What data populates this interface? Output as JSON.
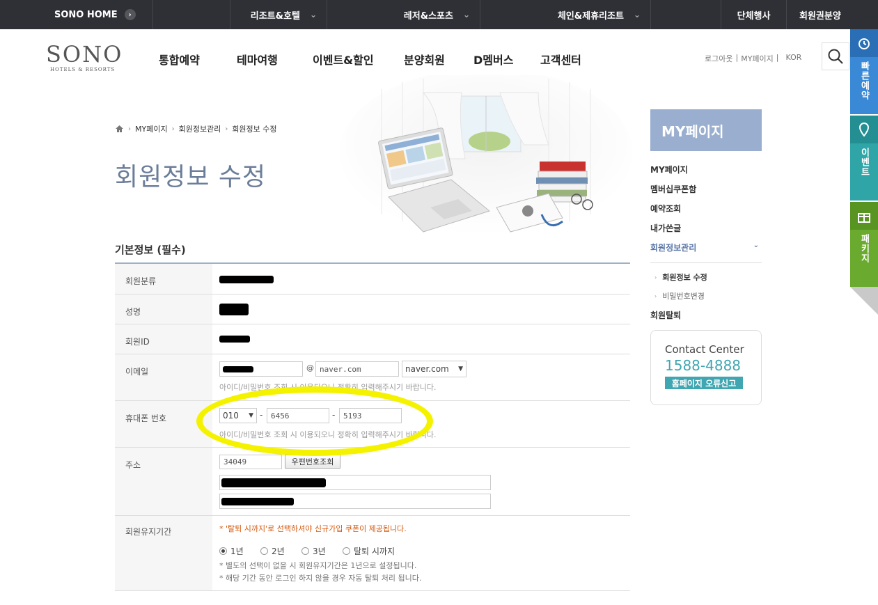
{
  "topbar": {
    "home": "SONO HOME",
    "menus": [
      {
        "label": "리조트&호텔"
      },
      {
        "label": "레저&스포츠"
      },
      {
        "label": "체인&제휴리조트"
      }
    ],
    "group": "단체행사",
    "membership": "회원권분양"
  },
  "logo": {
    "main": "SONO",
    "sub": "HOTELS & RESORTS"
  },
  "gnb": [
    "통합예약",
    "테마여행",
    "이벤트&할인",
    "분양회원",
    "D멤버스",
    "고객센터"
  ],
  "util": {
    "logout": "로그아웃",
    "mypage": "MY페이지",
    "lang": "KOR"
  },
  "quick": [
    {
      "label": "빠른예약",
      "color": "#3a89d6"
    },
    {
      "label": "이벤트",
      "color": "#2fa5a8"
    },
    {
      "label": "패키지",
      "color": "#6aaa2e"
    }
  ],
  "breadcrumb": [
    "MY페이지",
    "회원정보관리",
    "회원정보 수정"
  ],
  "page_title": "회원정보 수정",
  "section_title": "기본정보 (필수)",
  "form": {
    "member_type_label": "회원분류",
    "name_label": "성명",
    "id_label": "회원ID",
    "email_label": "이메일",
    "email_at": "@",
    "email_domain": "naver.com",
    "email_select": "naver.com",
    "email_help": "아이디/비밀번호 조회 시 이용되오니 정확히 입력해주시기 바랍니다.",
    "phone_label": "휴대폰 번호",
    "phone_prefix": "010",
    "phone_dash": "-",
    "phone_mid": "6456",
    "phone_last": "5193",
    "phone_help": "아이디/비밀번호 조회 시 이용되오니 정확히 입력해주시기 바랍니다.",
    "address_label": "주소",
    "zipcode": "34049",
    "zipcode_button": "우편번호조회",
    "period_label": "회원유지기간",
    "period_warning": "* '탈퇴 시까지'로 선택하셔야 신규가입 쿠폰이 제공됩니다.",
    "period_options": [
      "1년",
      "2년",
      "3년",
      "탈퇴 시까지"
    ],
    "period_selected": "1년",
    "period_note1": "* 별도의 선택이 없을 시 회원유지기간은 1년으로 설정됩니다.",
    "period_note2": "* 해당 기간 동안 로그인 하지 않을 경우 자동 탈퇴 처리 됩니다."
  },
  "side": {
    "title": "MY페이지",
    "menu": [
      "MY페이지",
      "멤버십쿠폰함",
      "예약조회",
      "내가쓴글",
      "회원정보관리"
    ],
    "submenu": [
      "회원정보 수정",
      "비밀번호변경"
    ],
    "withdraw": "회원탈퇴",
    "contact_title": "Contact Center",
    "contact_number": "1588-4888",
    "contact_button": "홈페이지 오류신고"
  }
}
